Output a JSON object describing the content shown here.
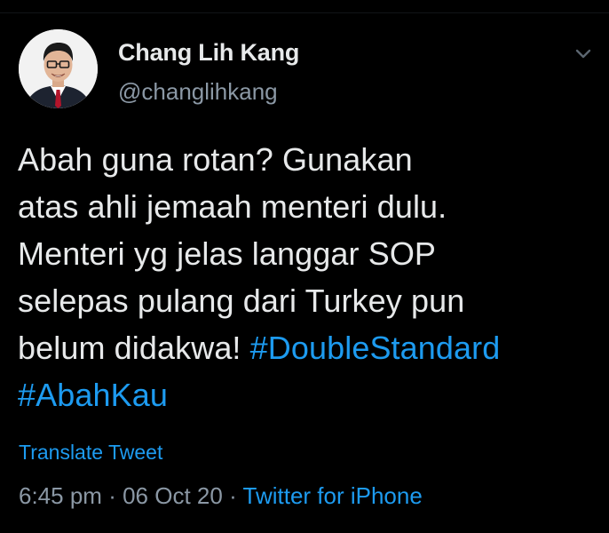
{
  "tweet": {
    "author": {
      "display_name": "Chang Lih Kang",
      "handle": "@changlihkang",
      "avatar_icon": "profile-photo"
    },
    "more_icon": "chevron-down-icon",
    "text_lines": [
      {
        "text": "Abah guna rotan? Gunakan"
      },
      {
        "text": "atas ahli jemaah menteri dulu."
      },
      {
        "text": "Menteri yg jelas langgar SOP"
      },
      {
        "text": "selepas pulang dari Turkey pun"
      },
      {
        "text": "belum didakwa! ",
        "hashtag": "#DoubleStandard"
      },
      {
        "hashtag": "#AbahKau"
      }
    ],
    "translate_label": "Translate Tweet",
    "time": "6:45 pm",
    "date": "06 Oct 20",
    "separator": "·",
    "source": "Twitter for iPhone"
  },
  "colors": {
    "background": "#000000",
    "text": "#e7e9ea",
    "secondary": "#8b98a5",
    "link": "#1d9bf0"
  }
}
